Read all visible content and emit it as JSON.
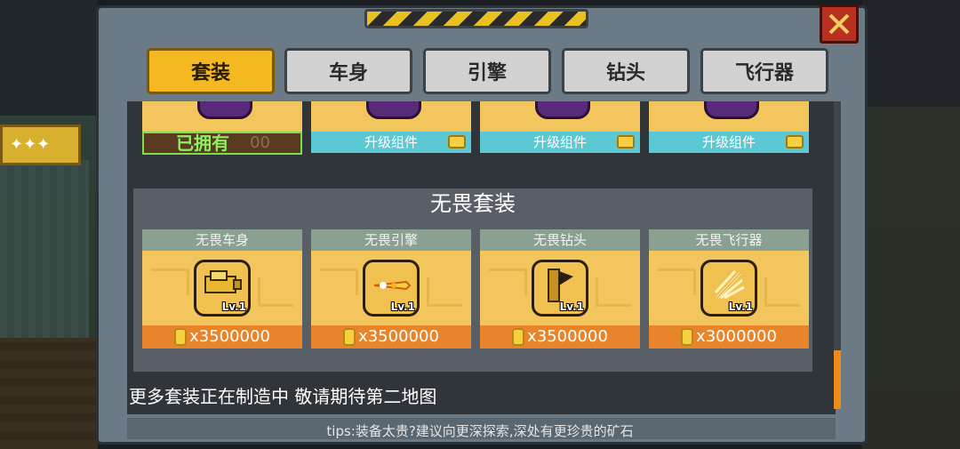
{
  "tabs": [
    {
      "label": "套装",
      "active": true
    },
    {
      "label": "车身",
      "active": false
    },
    {
      "label": "引擎",
      "active": false
    },
    {
      "label": "钻头",
      "active": false
    },
    {
      "label": "飞行器",
      "active": false
    }
  ],
  "top_row": {
    "owned_label": "已拥有",
    "owned_ghost": "00",
    "upgrade_label": "升级组件"
  },
  "suit": {
    "title": "无畏套装",
    "items": [
      {
        "name": "无畏车身",
        "level": "Lv.1",
        "price": "x3500000",
        "icon": "car-body-icon"
      },
      {
        "name": "无畏引擎",
        "level": "Lv.1",
        "price": "x3500000",
        "icon": "engine-icon"
      },
      {
        "name": "无畏钻头",
        "level": "Lv.1",
        "price": "x3500000",
        "icon": "drill-icon"
      },
      {
        "name": "无畏飞行器",
        "level": "Lv.1",
        "price": "x3000000",
        "icon": "wing-icon"
      }
    ]
  },
  "more_text": "更多套装正在制造中   敬请期待第二地图",
  "tips": "tips:装备太贵?建议向更深探索,深处有更珍贵的矿石",
  "colors": {
    "active_tab": "#f4b820",
    "price_bar": "#e8842a",
    "upgrade_bar": "#5cc8d4",
    "owned_text": "#8cf060"
  }
}
